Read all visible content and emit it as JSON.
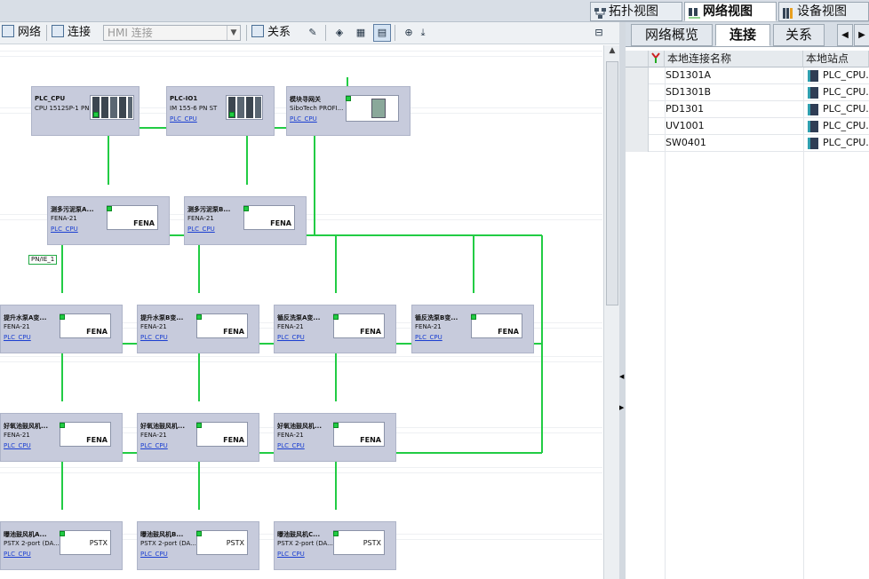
{
  "top_tabs": [
    {
      "label": "拓扑视图",
      "icon": "topology-icon"
    },
    {
      "label": "网络视图",
      "icon": "network-icon"
    },
    {
      "label": "设备视图",
      "icon": "device-icon"
    }
  ],
  "toolbar": {
    "network_label": "网络",
    "connect_label": "连接",
    "hmi_placeholder": "HMI 连接",
    "relations_label": "关系"
  },
  "devices": {
    "plc_cpu": {
      "name": "PLC_CPU",
      "type": "CPU 1512SP-1 PN"
    },
    "plc_io1": {
      "name": "PLC-IO1",
      "type": "IM 155-6 PN ST",
      "link": "PLC_CPU"
    },
    "gateway": {
      "name": "模块寻网关",
      "type": "SiboTech PROFI...",
      "link": "PLC_CPU"
    },
    "row2": [
      {
        "name": "测多污泥泵A...",
        "type": "FENA-21",
        "link": "PLC_CPU"
      },
      {
        "name": "测多污泥泵B...",
        "type": "FENA-21",
        "link": "PLC_CPU"
      }
    ],
    "row3": [
      {
        "name": "提升水泵A变...",
        "type": "FENA-21",
        "link": "PLC_CPU"
      },
      {
        "name": "提升水泵B变...",
        "type": "FENA-21",
        "link": "PLC_CPU"
      },
      {
        "name": "循反洗泵A变...",
        "type": "FENA-21",
        "link": "PLC_CPU"
      },
      {
        "name": "循反洗泵B变...",
        "type": "FENA-21",
        "link": "PLC_CPU"
      }
    ],
    "row4": [
      {
        "name": "好氧池鼓风机...",
        "type": "FENA-21",
        "link": "PLC_CPU"
      },
      {
        "name": "好氧池鼓风机...",
        "type": "FENA-21",
        "link": "PLC_CPU"
      },
      {
        "name": "好氧池鼓风机...",
        "type": "FENA-21",
        "link": "PLC_CPU"
      }
    ],
    "row5": [
      {
        "name": "曝池鼓风机A...",
        "type": "PSTX 2-port (DA...",
        "link": "PLC_CPU"
      },
      {
        "name": "曝池鼓风机B...",
        "type": "PSTX 2-port (DA...",
        "link": "PLC_CPU"
      },
      {
        "name": "曝池鼓风机C...",
        "type": "PSTX 2-port (DA...",
        "link": "PLC_CPU"
      }
    ]
  },
  "device_labels": {
    "fena": "FENA",
    "pstx": "PSTX"
  },
  "network_label": "PN/IE_1",
  "right_tabs": [
    "网络概览",
    "连接",
    "关系"
  ],
  "table": {
    "headers": [
      "本地连接名称",
      "本地站点"
    ],
    "rows": [
      {
        "name": "SD1301A",
        "station": "PLC_CPU..."
      },
      {
        "name": "SD1301B",
        "station": "PLC_CPU..."
      },
      {
        "name": "PD1301",
        "station": "PLC_CPU..."
      },
      {
        "name": "UV1001",
        "station": "PLC_CPU..."
      },
      {
        "name": "SW0401",
        "station": "PLC_CPU..."
      }
    ]
  },
  "colors": {
    "network": "#22cc44",
    "card": "#c7cbdc",
    "link": "#1b3fd1"
  }
}
